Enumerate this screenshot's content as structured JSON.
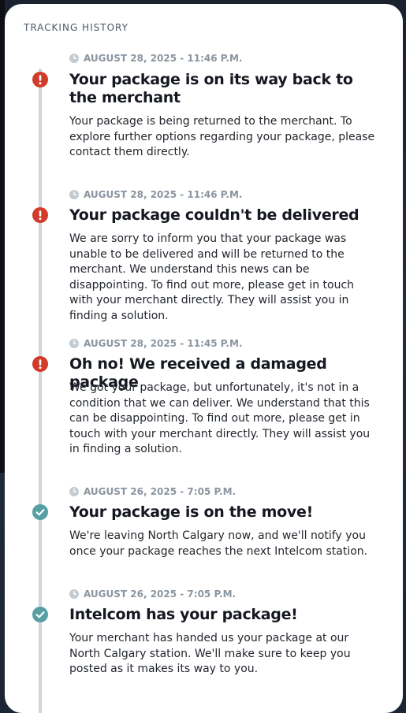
{
  "section": {
    "title": "TRACKING HISTORY"
  },
  "colors": {
    "alert": "#d13b2a",
    "success": "#56a0a3",
    "rail": "#cfd6db",
    "meta": "#8b95a0"
  },
  "events": [
    {
      "timestamp": "AUGUST 28, 2025 - 11:46 P.M.",
      "status": "alert",
      "icon": "exclamation-icon",
      "title": "Your package is on its way back to the merchant",
      "description": "Your package is being returned to the merchant. To explore further options regarding your package, please contact them directly."
    },
    {
      "timestamp": "AUGUST 28, 2025 - 11:46 P.M.",
      "status": "alert",
      "icon": "exclamation-icon",
      "title": "Your package couldn't be delivered",
      "description": "We are sorry to inform you that your package was unable to be delivered and will be returned to the merchant. We understand this news can be disappointing. To find out more, please get in touch with your merchant directly. They will assist you in finding a solution."
    },
    {
      "timestamp": "AUGUST 28, 2025 - 11:45 P.M.",
      "status": "alert",
      "icon": "exclamation-icon",
      "title": "Oh no! We received a damaged package",
      "description": "We got your package, but unfortunately, it's not in a condition that we can deliver. We understand that this can be disappointing. To find out more, please get in touch with your merchant directly. They will assist you in finding a solution."
    },
    {
      "timestamp": "AUGUST 26, 2025 - 7:05 P.M.",
      "status": "success",
      "icon": "checkmark-icon",
      "title": "Your package is on the move!",
      "description": "We're leaving North Calgary now, and we'll notify you once your package reaches the next Intelcom station."
    },
    {
      "timestamp": "AUGUST 26, 2025 - 7:05 P.M.",
      "status": "success",
      "icon": "checkmark-icon",
      "title": "Intelcom has your package!",
      "description": "Your merchant has handed us your package at our North Calgary station. We'll make sure to keep you posted as it makes its way to you."
    }
  ]
}
